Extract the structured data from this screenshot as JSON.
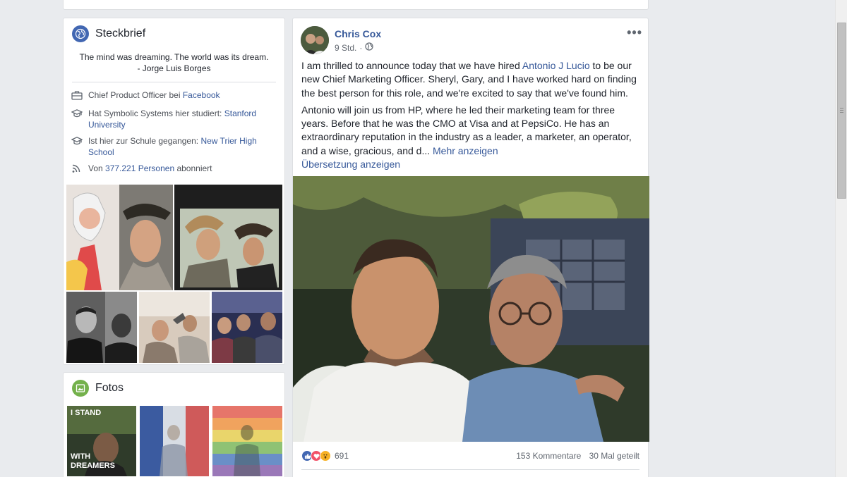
{
  "intro": {
    "title": "Steckbrief",
    "quote_line1": "The mind was dreaming. The world was its dream.",
    "quote_line2": "- Jorge Luis Borges",
    "items": [
      {
        "icon": "briefcase-icon",
        "text": "Chief Product Officer bei ",
        "link": "Facebook"
      },
      {
        "icon": "graduation-cap-icon",
        "text": "Hat Symbolic Systems hier studiert: ",
        "link": "Stanford University"
      },
      {
        "icon": "graduation-cap-icon",
        "text": "Ist hier zur Schule gegangen: ",
        "link": "New Trier High School"
      },
      {
        "icon": "rss-icon",
        "text": "Von ",
        "link": "377.221 Personen",
        "text_after": " abonniert"
      }
    ]
  },
  "photos": {
    "title": "Fotos",
    "photo1_line1": "I STAND",
    "photo1_line2": "WITH",
    "photo1_line3": "DREAMERS"
  },
  "post": {
    "author": "Chris Cox",
    "time": "9 Std.",
    "para1_before": "I am thrilled to announce today that we have hired ",
    "para1_link": "Antonio J Lucio",
    "para1_after": " to be our new Chief Marketing Officer. Sheryl, Gary, and I have worked hard on finding the best person for this role, and we're excited to say that we've found him.",
    "para2": "Antonio will join us from HP, where he led their marketing team for three years. Before that he was the CMO at Visa and at PepsiCo. He has an extraordinary reputation in the industry as a leader, a marketer, an operator, and a wise, gracious, and d...",
    "see_more": "Mehr anzeigen",
    "translate": "Übersetzung anzeigen",
    "reaction_count": "691",
    "comments": "153 Kommentare",
    "shares": "30 Mal geteilt"
  },
  "colors": {
    "link": "#365899",
    "background": "#e9ebee",
    "like_blue": "#4267b2",
    "love_red": "#f25268",
    "wow_yellow": "#f7b125"
  }
}
